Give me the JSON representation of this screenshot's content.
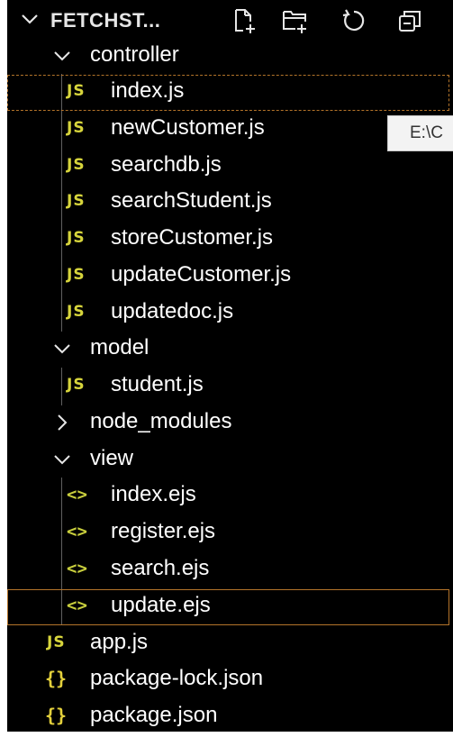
{
  "header": {
    "title": "FETCHST...",
    "actions": [
      {
        "name": "new-file-icon"
      },
      {
        "name": "new-folder-icon"
      },
      {
        "name": "refresh-icon"
      },
      {
        "name": "collapse-all-icon"
      }
    ]
  },
  "tree": {
    "controller": {
      "label": "controller",
      "files": [
        "index.js",
        "newCustomer.js",
        "searchdb.js",
        "searchStudent.js",
        "storeCustomer.js",
        "updateCustomer.js",
        "updatedoc.js"
      ]
    },
    "model": {
      "label": "model",
      "files": [
        "student.js"
      ]
    },
    "node_modules": {
      "label": "node_modules"
    },
    "view": {
      "label": "view",
      "files": [
        "index.ejs",
        "register.ejs",
        "search.ejs",
        "update.ejs"
      ]
    },
    "root_files": [
      "app.js",
      "package-lock.json",
      "package.json"
    ]
  },
  "icons": {
    "js": "JS",
    "ejs": "<>",
    "json": "{}"
  },
  "tooltip": {
    "text": "E:\\C"
  },
  "colors": {
    "background": "#000000",
    "js_icon": "#d7d53c",
    "ejs_icon": "#c9cf3d",
    "json_icon": "#e3d03c",
    "focus_border": "#b4742a",
    "indent_guide": "#5f5f5f"
  }
}
